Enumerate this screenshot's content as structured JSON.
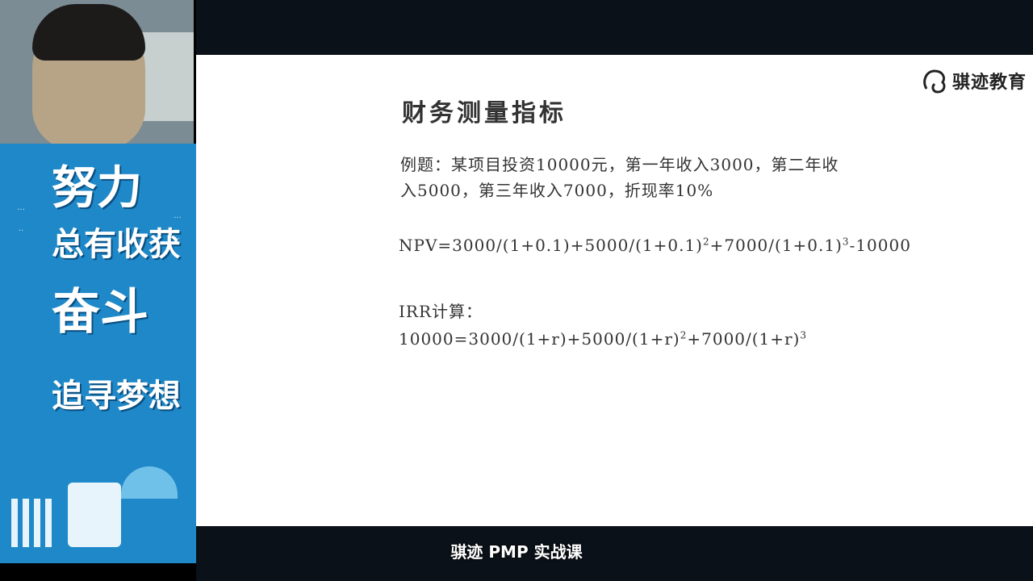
{
  "slide": {
    "title": "财务测量指标",
    "example_line1": "例题：某项目投资10000元，第一年收入3000，第二年收",
    "example_line2": "入5000，第三年收入7000，折现率10%",
    "npv_part1": "NPV=3000/(1+0.1)+5000/(1+0.1)",
    "npv_exp1": "2",
    "npv_part2": "+7000/(1+0.1)",
    "npv_exp2": "3",
    "npv_part3": "-10000",
    "irr_heading": "IRR计算：",
    "irr_part1": "10000=3000/(1+r)+5000/(1+r)",
    "irr_exp1": "2",
    "irr_part2": "+7000/(1+r)",
    "irr_exp2": "3"
  },
  "logo": {
    "text": "骐迹教育",
    "icon": "qiji-logo-icon"
  },
  "subtitle": "骐迹 PMP 实战课",
  "poster": {
    "line1": "努力",
    "line2": "总有收获",
    "line3": "奋斗",
    "line4": "追寻梦想"
  }
}
